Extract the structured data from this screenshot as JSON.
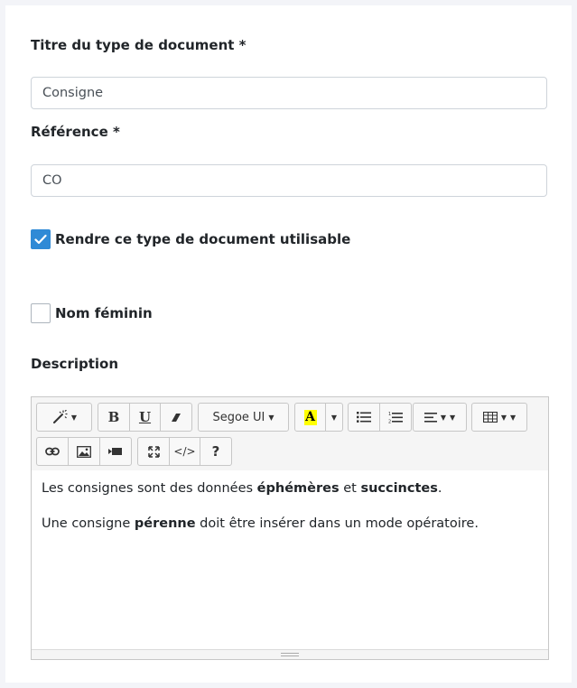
{
  "form": {
    "title_label": "Titre du type de document *",
    "title_value": "Consigne",
    "reference_label": "Référence *",
    "reference_value": "CO",
    "usable_label": "Rendre ce type de document utilisable",
    "usable_checked": true,
    "feminine_label": "Nom féminin",
    "feminine_checked": false,
    "description_label": "Description"
  },
  "editor": {
    "toolbar": {
      "style_icon": "magic-wand-icon",
      "bold_label": "B",
      "underline_label": "U",
      "clear_icon": "eraser-icon",
      "font_name": "Segoe UI",
      "color_label": "A",
      "highlight_color": "#ffff00",
      "ul_icon": "unordered-list-icon",
      "ol_icon": "ordered-list-icon",
      "align_icon": "align-left-icon",
      "table_icon": "table-icon",
      "link_icon": "link-icon",
      "picture_icon": "picture-icon",
      "video_icon": "video-icon",
      "fullscreen_icon": "expand-icon",
      "code_label": "</>",
      "help_label": "?"
    },
    "content": {
      "p1_before": "Les consignes sont des données ",
      "p1_bold1": "éphémères",
      "p1_mid": " et ",
      "p1_bold2": "succinctes",
      "p1_after": ".",
      "p2_before": "Une consigne ",
      "p2_bold": "pérenne",
      "p2_after": " doit être insérer dans un mode opératoire."
    }
  },
  "colors": {
    "accent": "#2f8ad6",
    "text": "#212529",
    "border": "#ced4da"
  }
}
